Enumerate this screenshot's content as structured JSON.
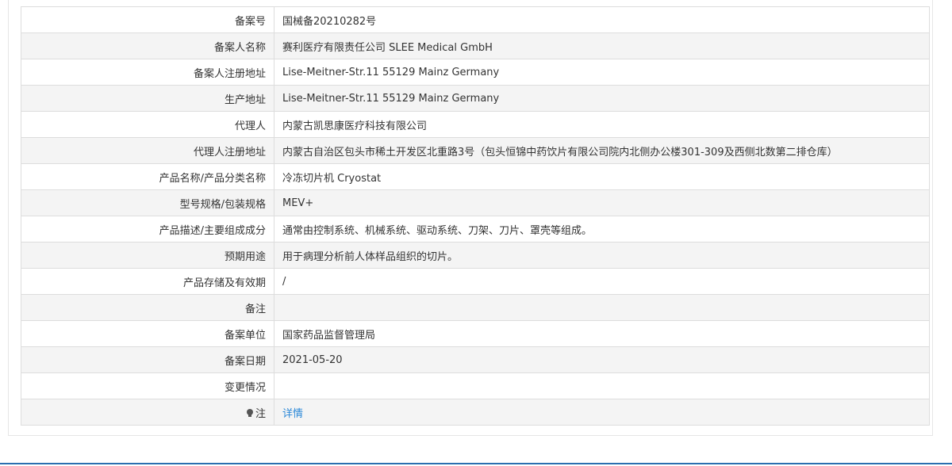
{
  "record": {
    "rows": [
      {
        "label": "备案号",
        "value": "国械备20210282号"
      },
      {
        "label": "备案人名称",
        "value": "赛利医疗有限责任公司 SLEE Medical GmbH"
      },
      {
        "label": "备案人注册地址",
        "value": "Lise-Meitner-Str.11 55129 Mainz Germany"
      },
      {
        "label": "生产地址",
        "value": "Lise-Meitner-Str.11 55129 Mainz Germany"
      },
      {
        "label": "代理人",
        "value": "内蒙古凯思康医疗科技有限公司"
      },
      {
        "label": "代理人注册地址",
        "value": "内蒙古自治区包头市稀土开发区北重路3号（包头恒锦中药饮片有限公司院内北侧办公楼301-309及西侧北数第二排仓库）"
      },
      {
        "label": "产品名称/产品分类名称",
        "value": "冷冻切片机 Cryostat"
      },
      {
        "label": "型号规格/包装规格",
        "value": "MEV+"
      },
      {
        "label": "产品描述/主要组成成分",
        "value": "通常由控制系统、机械系统、驱动系统、刀架、刀片、罩壳等组成。"
      },
      {
        "label": "预期用途",
        "value": "用于病理分析前人体样品组织的切片。"
      },
      {
        "label": "产品存储及有效期",
        "value": "/"
      },
      {
        "label": "备注",
        "value": ""
      },
      {
        "label": "备案单位",
        "value": "国家药品监督管理局"
      },
      {
        "label": "备案日期",
        "value": "2021-05-20"
      },
      {
        "label": "变更情况",
        "value": ""
      }
    ],
    "note": {
      "label": "注",
      "icon": "lightbulb-icon",
      "link_text": "详情",
      "link_color": "#2b88d8"
    }
  },
  "colors": {
    "border": "#dddddd",
    "stripe": "#f4f4f4",
    "bottom_bar": "#2a6fb0"
  }
}
